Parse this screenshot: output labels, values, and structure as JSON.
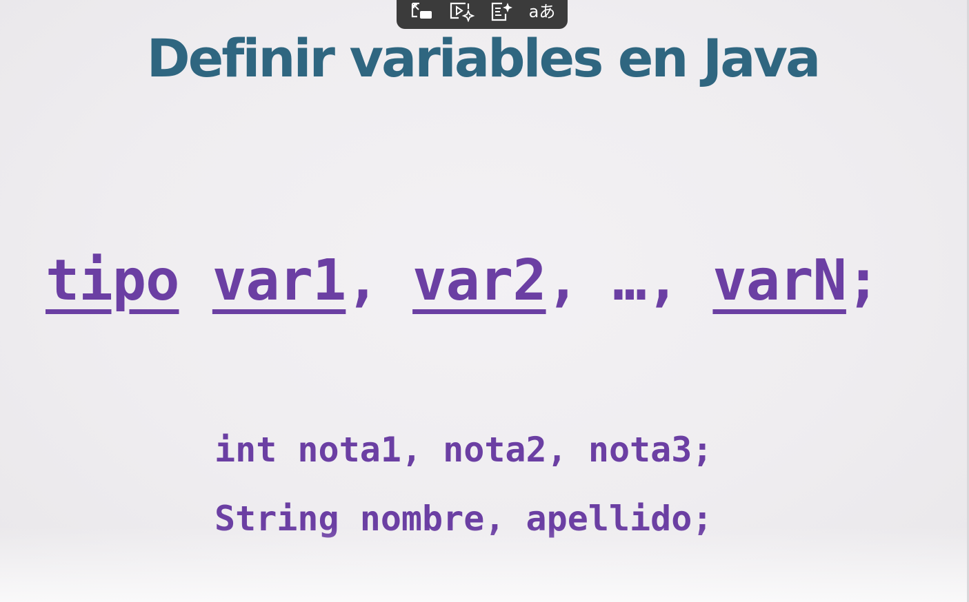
{
  "toolbar": {
    "buttons": [
      {
        "icon": "picture-in-picture-icon"
      },
      {
        "icon": "video-sparkle-icon"
      },
      {
        "icon": "document-sparkle-icon"
      },
      {
        "icon": "translate-icon",
        "glyph": "aあ"
      }
    ]
  },
  "slide": {
    "title": "Definir variables en Java",
    "syntax": {
      "tipo": "tipo",
      "var1": "var1",
      "sep1": ", ",
      "var2": "var2",
      "sep2": ", …, ",
      "varN": "varN",
      "end": ";"
    },
    "examples": [
      "int nota1, nota2, nota3;",
      "String nombre, apellido;"
    ]
  },
  "colors": {
    "title": "#2f6680",
    "code": "#6b3fa3",
    "toolbar": "#3b3b3b"
  }
}
